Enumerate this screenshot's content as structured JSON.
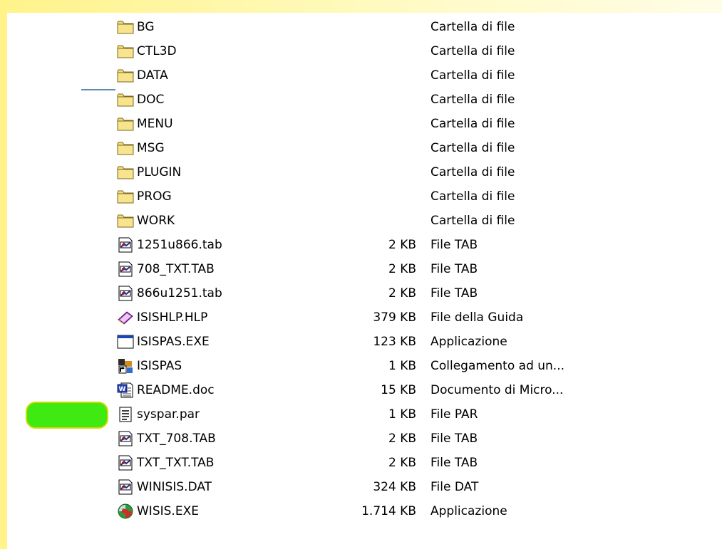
{
  "files": [
    {
      "icon": "folder-icon",
      "name": "BG",
      "size": "",
      "type": "Cartella di file"
    },
    {
      "icon": "folder-icon",
      "name": "CTL3D",
      "size": "",
      "type": "Cartella di file"
    },
    {
      "icon": "folder-icon",
      "name": "DATA",
      "size": "",
      "type": "Cartella di file"
    },
    {
      "icon": "folder-icon",
      "name": "DOC",
      "size": "",
      "type": "Cartella di file"
    },
    {
      "icon": "folder-icon",
      "name": "MENU",
      "size": "",
      "type": "Cartella di file"
    },
    {
      "icon": "folder-icon",
      "name": "MSG",
      "size": "",
      "type": "Cartella di file"
    },
    {
      "icon": "folder-icon",
      "name": "PLUGIN",
      "size": "",
      "type": "Cartella di file"
    },
    {
      "icon": "folder-icon",
      "name": "PROG",
      "size": "",
      "type": "Cartella di file"
    },
    {
      "icon": "folder-icon",
      "name": "WORK",
      "size": "",
      "type": "Cartella di file"
    },
    {
      "icon": "tab-file-icon",
      "name": "1251u866.tab",
      "size": "2 KB",
      "type": "File TAB"
    },
    {
      "icon": "tab-file-icon",
      "name": "708_TXT.TAB",
      "size": "2 KB",
      "type": "File TAB"
    },
    {
      "icon": "tab-file-icon",
      "name": "866u1251.tab",
      "size": "2 KB",
      "type": "File TAB"
    },
    {
      "icon": "help-file-icon",
      "name": "ISISHLP.HLP",
      "size": "379 KB",
      "type": "File della Guida"
    },
    {
      "icon": "application-icon",
      "name": "ISISPAS.EXE",
      "size": "123 KB",
      "type": "Applicazione"
    },
    {
      "icon": "shortcut-icon",
      "name": "ISISPAS",
      "size": "1 KB",
      "type": "Collegamento ad un..."
    },
    {
      "icon": "word-document-icon",
      "name": "README.doc",
      "size": "15 KB",
      "type": "Documento di Micro..."
    },
    {
      "icon": "text-file-icon",
      "name": "syspar.par",
      "size": "1 KB",
      "type": "File PAR"
    },
    {
      "icon": "tab-file-icon",
      "name": "TXT_708.TAB",
      "size": "2 KB",
      "type": "File TAB"
    },
    {
      "icon": "tab-file-icon",
      "name": "TXT_TXT.TAB",
      "size": "2 KB",
      "type": "File TAB"
    },
    {
      "icon": "tab-file-icon",
      "name": "WINISIS.DAT",
      "size": "324 KB",
      "type": "File DAT"
    },
    {
      "icon": "wisis-app-icon",
      "name": "WISIS.EXE",
      "size": "1.714 KB",
      "type": "Applicazione"
    }
  ],
  "colors": {
    "frame": "#fff38a",
    "marker": "#3eea12",
    "connector": "#5f8bb3"
  }
}
